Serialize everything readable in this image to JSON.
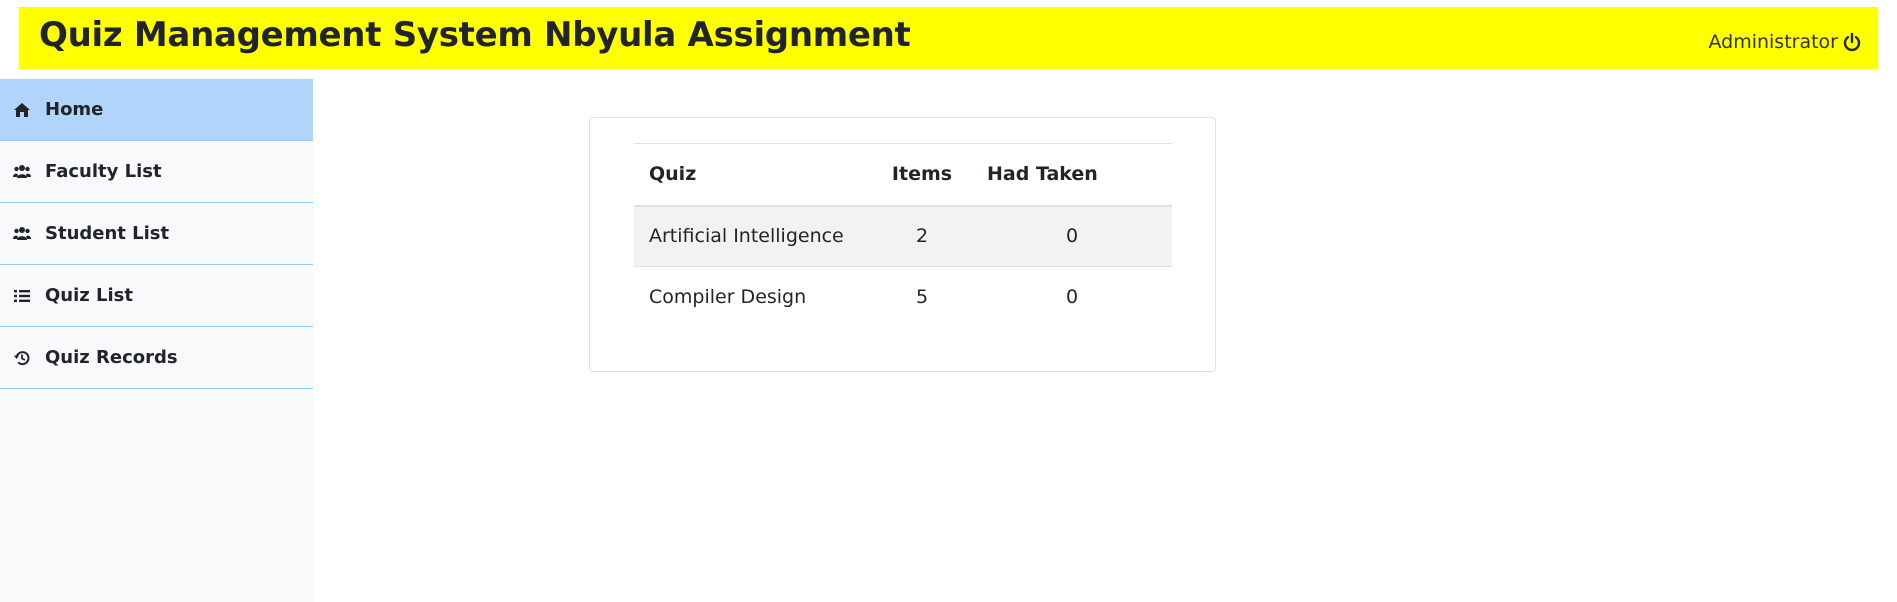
{
  "header": {
    "title": "Quiz Management System Nbyula Assignment",
    "user": "Administrator",
    "logout_icon": "power-icon",
    "background": "#ffff00"
  },
  "sidebar": {
    "items": [
      {
        "label": "Home",
        "icon": "home-icon",
        "active": true
      },
      {
        "label": "Faculty List",
        "icon": "users-icon",
        "active": false
      },
      {
        "label": "Student List",
        "icon": "users-icon",
        "active": false
      },
      {
        "label": "Quiz List",
        "icon": "list-icon",
        "active": false
      },
      {
        "label": "Quiz Records",
        "icon": "history-icon",
        "active": false
      }
    ],
    "active_color": "#b0d4fa"
  },
  "quiz_table": {
    "columns": [
      "Quiz",
      "Items",
      "Had Taken"
    ],
    "rows": [
      {
        "quiz": "Artificial Intelligence",
        "items": "2",
        "taken": "0"
      },
      {
        "quiz": "Compiler Design",
        "items": "5",
        "taken": "0"
      }
    ]
  }
}
